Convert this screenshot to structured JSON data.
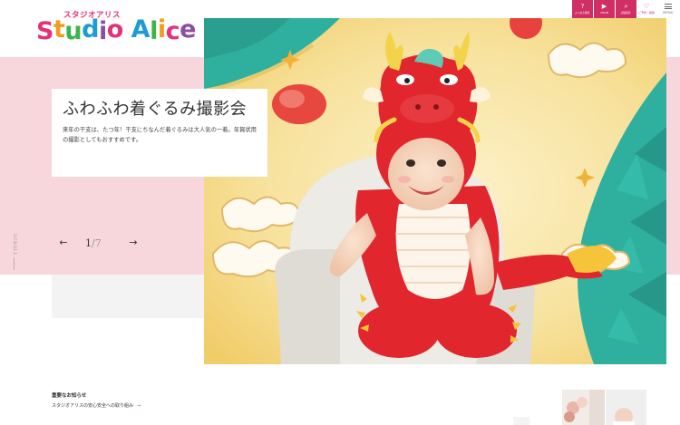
{
  "logo": {
    "kana": "スタジオアリス",
    "letters": [
      "S",
      "t",
      "u",
      "d",
      "i",
      "o",
      " ",
      "A",
      "l",
      "i",
      "c",
      "e"
    ],
    "letter_colors": [
      "#e4327a",
      "#f29c1f",
      "#3bb54a",
      "#1d9bd7",
      "#8b4ea2",
      "#e4327a",
      "#ffffff",
      "#1d9bd7",
      "#3bb54a",
      "#f29c1f",
      "#e4327a",
      "#8b4ea2"
    ]
  },
  "nav": {
    "items": [
      {
        "label": "よくある質問",
        "icon": "?"
      },
      {
        "label": "MOVIE",
        "icon": "▶"
      },
      {
        "label": "店舗検索",
        "icon": "⌕"
      },
      {
        "label": "ご予約・確認",
        "icon": "♡"
      }
    ],
    "menu_label": "MENU"
  },
  "hero": {
    "title": "ふわふわ着ぐるみ撮影会",
    "description": "来年の干支は、たつ年！干支にちなんだ着ぐるみは大人気の一着。年賀状用の撮影としてもおすすめです。",
    "current_slide": "1",
    "total_slides": "7",
    "prev_arrow": "←",
    "next_arrow": "→"
  },
  "scroll_label": "SCROLL",
  "notice": {
    "heading": "重要なお知らせ",
    "link_text": "スタジオアリスの安心安全への取り組み",
    "link_arrow": "→"
  },
  "colors": {
    "brand_pink": "#cf2f65",
    "band_pink": "#f7d6dc",
    "teal": "#2fb09f",
    "gold": "#f5d77a",
    "dragon_red": "#e1262d"
  }
}
